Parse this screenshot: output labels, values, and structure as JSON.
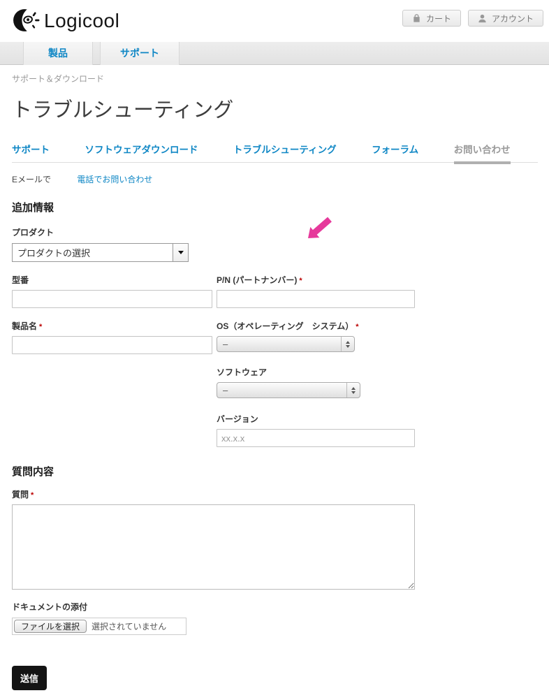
{
  "colors": {
    "accent_blue": "#0f87c5",
    "required_red": "#bb0000",
    "annotation_pink": "#e6399b",
    "submit_bg": "#141414"
  },
  "header": {
    "logo_text": "Logicool",
    "cart_label": "カート",
    "account_label": "アカウント"
  },
  "main_nav": {
    "items": [
      {
        "label": "製品"
      },
      {
        "label": "サポート"
      }
    ]
  },
  "breadcrumb": "サポート＆ダウンロード",
  "page_title": "トラブルシューティング",
  "tabs": [
    {
      "label": "サポート",
      "active": false
    },
    {
      "label": "ソフトウェアダウンロード",
      "active": false
    },
    {
      "label": "トラブルシューティング",
      "active": false
    },
    {
      "label": "フォーラム",
      "active": false
    },
    {
      "label": "お問い合わせ",
      "active": true
    }
  ],
  "contact_options": {
    "email_label": "Eメールで",
    "phone_link": "電話でお問い合わせ"
  },
  "form": {
    "required_marker": "*",
    "section_additional": "追加情報",
    "fields": {
      "product": {
        "label": "プロダクト",
        "value": "プロダクトの選択"
      },
      "model": {
        "label": "型番",
        "value": ""
      },
      "part_number": {
        "label": "P/N (パートナンバー)",
        "value": "",
        "required": true
      },
      "product_name": {
        "label": "製品名",
        "value": "",
        "required": true
      },
      "os": {
        "label": "OS（オペレーティング　システム）",
        "value": "–",
        "required": true
      },
      "software": {
        "label": "ソフトウェア",
        "value": "–"
      },
      "version": {
        "label": "バージョン",
        "value": "",
        "placeholder": "xx.x.x"
      }
    },
    "section_question": "質問内容",
    "question": {
      "label": "質問",
      "value": "",
      "required": true
    },
    "attachment": {
      "label": "ドキュメントの添付",
      "button_label": "ファイルを選択",
      "status": "選択されていません"
    },
    "submit_label": "送信"
  }
}
